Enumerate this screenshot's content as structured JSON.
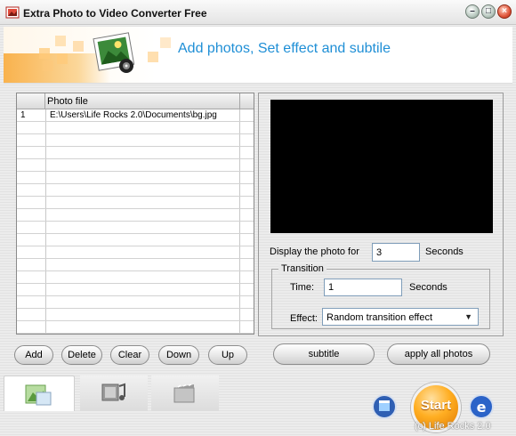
{
  "window": {
    "title": "Extra Photo to Video Converter Free"
  },
  "window_controls": {
    "minimize": "–",
    "maximize": "□",
    "close": "×"
  },
  "banner": {
    "title": "Add photos, Set effect and subtile"
  },
  "photo_list": {
    "header": "Photo file",
    "rows": [
      {
        "index": "1",
        "path": "E:\\Users\\Life Rocks 2.0\\Documents\\bg.jpg"
      }
    ]
  },
  "settings": {
    "display_label": "Display the photo for",
    "display_value": "3",
    "display_unit": "Seconds",
    "transition_legend": "Transition",
    "time_label": "Time:",
    "time_value": "1",
    "time_unit": "Seconds",
    "effect_label": "Effect:",
    "effect_value": "Random transition effect"
  },
  "list_buttons": {
    "add": "Add",
    "delete": "Delete",
    "clear": "Clear",
    "down": "Down",
    "up": "Up"
  },
  "settings_buttons": {
    "subtitle": "subtitle",
    "apply_all": "apply all photos"
  },
  "footer": {
    "start": "Start",
    "copyright": "(c) Life Rocks 2.0"
  },
  "colors": {
    "accent_blue": "#1f8fd6",
    "start_orange": "#ffae22",
    "preview_bg": "#000000"
  },
  "icons": [
    "app-icon",
    "photos-tab-icon",
    "music-tab-icon",
    "video-tab-icon",
    "film-icon",
    "ie-icon"
  ]
}
